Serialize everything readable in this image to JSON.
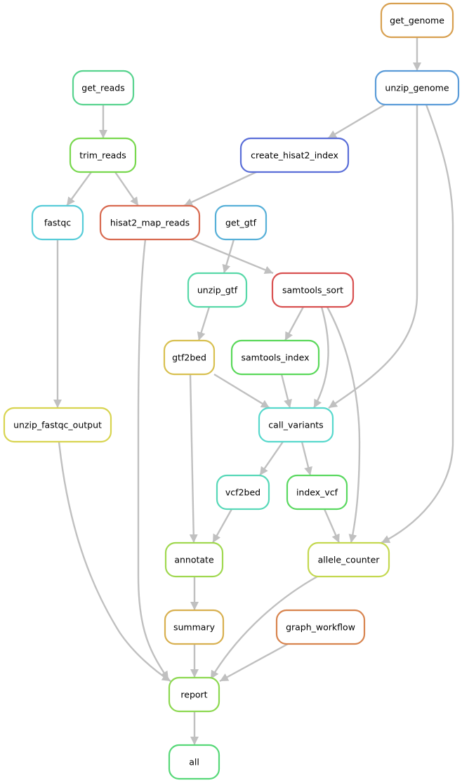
{
  "nodes": [
    {
      "id": "get_genome",
      "label": "get_genome",
      "color": "#d8a050"
    },
    {
      "id": "unzip_genome",
      "label": "unzip_genome",
      "color": "#5a9bd8"
    },
    {
      "id": "get_reads",
      "label": "get_reads",
      "color": "#57d38e"
    },
    {
      "id": "trim_reads",
      "label": "trim_reads",
      "color": "#78d84e"
    },
    {
      "id": "create_hisat2_index",
      "label": "create_hisat2_index",
      "color": "#5a6ed8"
    },
    {
      "id": "fastqc",
      "label": "fastqc",
      "color": "#57ccd8"
    },
    {
      "id": "hisat2_map_reads",
      "label": "hisat2_map_reads",
      "color": "#d86a50"
    },
    {
      "id": "get_gtf",
      "label": "get_gtf",
      "color": "#57b0d8"
    },
    {
      "id": "unzip_gtf",
      "label": "unzip_gtf",
      "color": "#57d8a8"
    },
    {
      "id": "samtools_sort",
      "label": "samtools_sort",
      "color": "#d85050"
    },
    {
      "id": "gtf2bed",
      "label": "gtf2bed",
      "color": "#d8c050"
    },
    {
      "id": "samtools_index",
      "label": "samtools_index",
      "color": "#5ad85a"
    },
    {
      "id": "unzip_fastqc_output",
      "label": "unzip_fastqc_output",
      "color": "#d8d450"
    },
    {
      "id": "call_variants",
      "label": "call_variants",
      "color": "#57d8cc"
    },
    {
      "id": "vcf2bed",
      "label": "vcf2bed",
      "color": "#57d8b8"
    },
    {
      "id": "index_vcf",
      "label": "index_vcf",
      "color": "#5ad860"
    },
    {
      "id": "annotate",
      "label": "annotate",
      "color": "#a0d850"
    },
    {
      "id": "allele_counter",
      "label": "allele_counter",
      "color": "#c4d850"
    },
    {
      "id": "summary",
      "label": "summary",
      "color": "#d8b050"
    },
    {
      "id": "graph_workflow",
      "label": "graph_workflow",
      "color": "#d8844e"
    },
    {
      "id": "report",
      "label": "report",
      "color": "#8cd850"
    },
    {
      "id": "all",
      "label": "all",
      "color": "#57d878"
    }
  ],
  "edges": [
    [
      "get_genome",
      "unzip_genome"
    ],
    [
      "unzip_genome",
      "create_hisat2_index"
    ],
    [
      "unzip_genome",
      "call_variants"
    ],
    [
      "unzip_genome",
      "allele_counter"
    ],
    [
      "get_reads",
      "trim_reads"
    ],
    [
      "trim_reads",
      "fastqc"
    ],
    [
      "trim_reads",
      "hisat2_map_reads"
    ],
    [
      "create_hisat2_index",
      "hisat2_map_reads"
    ],
    [
      "hisat2_map_reads",
      "samtools_sort"
    ],
    [
      "hisat2_map_reads",
      "report"
    ],
    [
      "get_gtf",
      "unzip_gtf"
    ],
    [
      "unzip_gtf",
      "gtf2bed"
    ],
    [
      "samtools_sort",
      "samtools_index"
    ],
    [
      "samtools_sort",
      "call_variants"
    ],
    [
      "samtools_sort",
      "allele_counter"
    ],
    [
      "gtf2bed",
      "call_variants"
    ],
    [
      "gtf2bed",
      "annotate"
    ],
    [
      "samtools_index",
      "call_variants"
    ],
    [
      "fastqc",
      "unzip_fastqc_output"
    ],
    [
      "unzip_fastqc_output",
      "report"
    ],
    [
      "call_variants",
      "vcf2bed"
    ],
    [
      "call_variants",
      "index_vcf"
    ],
    [
      "vcf2bed",
      "annotate"
    ],
    [
      "index_vcf",
      "allele_counter"
    ],
    [
      "annotate",
      "summary"
    ],
    [
      "allele_counter",
      "report"
    ],
    [
      "summary",
      "report"
    ],
    [
      "graph_workflow",
      "report"
    ],
    [
      "report",
      "all"
    ]
  ],
  "edge_color": "#c0c0c0"
}
